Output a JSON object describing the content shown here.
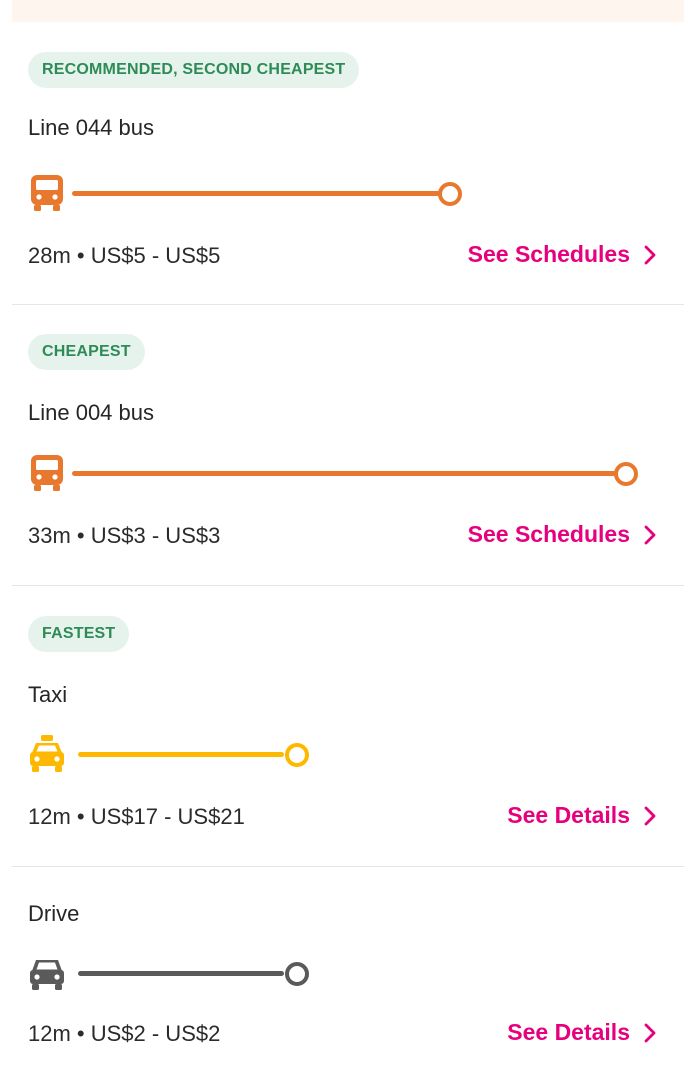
{
  "routes": [
    {
      "badge": "RECOMMENDED, SECOND CHEAPEST",
      "name": "Line 044 bus",
      "mode_icon": "bus-icon",
      "summary": "28m • US$5 - US$5",
      "action_label": "See Schedules",
      "color": "#e8782e"
    },
    {
      "badge": "CHEAPEST",
      "name": "Line 004 bus",
      "mode_icon": "bus-icon",
      "summary": "33m • US$3 - US$3",
      "action_label": "See Schedules",
      "color": "#e8782e"
    },
    {
      "badge": "FASTEST",
      "name": "Taxi",
      "mode_icon": "taxi-icon",
      "summary": "12m • US$17 - US$21",
      "action_label": "See Details",
      "color": "#ffb800"
    },
    {
      "name": "Drive",
      "mode_icon": "car-icon",
      "summary": "12m • US$2 - US$2",
      "action_label": "See Details",
      "color": "#5a5a5a"
    }
  ],
  "colors": {
    "badge_bg": "#e6f3ec",
    "badge_text": "#2e8b57",
    "action": "#e6007e"
  }
}
